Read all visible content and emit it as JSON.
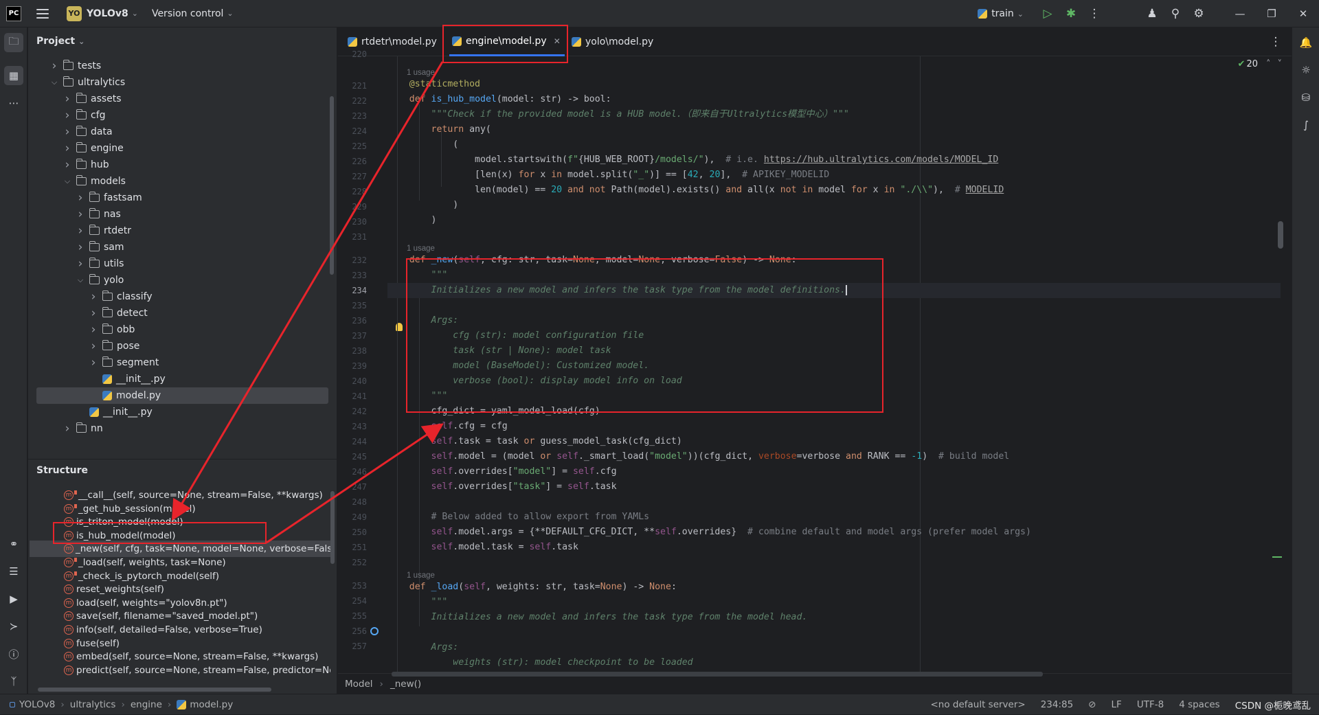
{
  "topbar": {
    "logo": "PC",
    "project_badge": "YO",
    "project_name": "YOLOv8",
    "version_control": "Version control",
    "run_config": "train"
  },
  "project_panel": {
    "title": "Project",
    "tree": [
      {
        "label": "tests",
        "type": "folder",
        "depth": 1,
        "expanded": false
      },
      {
        "label": "ultralytics",
        "type": "folder",
        "depth": 1,
        "expanded": true
      },
      {
        "label": "assets",
        "type": "folder",
        "depth": 2,
        "expanded": false
      },
      {
        "label": "cfg",
        "type": "folder",
        "depth": 2,
        "expanded": false
      },
      {
        "label": "data",
        "type": "folder",
        "depth": 2,
        "expanded": false
      },
      {
        "label": "engine",
        "type": "folder",
        "depth": 2,
        "expanded": false
      },
      {
        "label": "hub",
        "type": "folder",
        "depth": 2,
        "expanded": false
      },
      {
        "label": "models",
        "type": "folder",
        "depth": 2,
        "expanded": true
      },
      {
        "label": "fastsam",
        "type": "folder",
        "depth": 3,
        "expanded": false
      },
      {
        "label": "nas",
        "type": "folder",
        "depth": 3,
        "expanded": false
      },
      {
        "label": "rtdetr",
        "type": "folder",
        "depth": 3,
        "expanded": false
      },
      {
        "label": "sam",
        "type": "folder",
        "depth": 3,
        "expanded": false
      },
      {
        "label": "utils",
        "type": "folder",
        "depth": 3,
        "expanded": false
      },
      {
        "label": "yolo",
        "type": "folder",
        "depth": 3,
        "expanded": true
      },
      {
        "label": "classify",
        "type": "folder",
        "depth": 4,
        "expanded": false
      },
      {
        "label": "detect",
        "type": "folder",
        "depth": 4,
        "expanded": false
      },
      {
        "label": "obb",
        "type": "folder",
        "depth": 4,
        "expanded": false
      },
      {
        "label": "pose",
        "type": "folder",
        "depth": 4,
        "expanded": false
      },
      {
        "label": "segment",
        "type": "folder",
        "depth": 4,
        "expanded": false
      },
      {
        "label": "__init__.py",
        "type": "file",
        "depth": 4
      },
      {
        "label": "model.py",
        "type": "file",
        "depth": 4,
        "selected": true
      },
      {
        "label": "__init__.py",
        "type": "file",
        "depth": 3
      },
      {
        "label": "nn",
        "type": "folder",
        "depth": 2,
        "expanded": false
      }
    ]
  },
  "structure_panel": {
    "title": "Structure",
    "items": [
      {
        "label": "__call__(self, source=None, stream=False, **kwargs)",
        "private": true
      },
      {
        "label": "_get_hub_session(model)",
        "private": true
      },
      {
        "label": "is_triton_model(model)",
        "private": false
      },
      {
        "label": "is_hub_model(model)",
        "private": false
      },
      {
        "label": "_new(self, cfg, task=None, model=None, verbose=False)",
        "private": true,
        "selected": true
      },
      {
        "label": "_load(self, weights, task=None)",
        "private": true
      },
      {
        "label": "_check_is_pytorch_model(self)",
        "private": true
      },
      {
        "label": "reset_weights(self)",
        "private": false
      },
      {
        "label": "load(self, weights=\"yolov8n.pt\")",
        "private": false
      },
      {
        "label": "save(self, filename=\"saved_model.pt\")",
        "private": false
      },
      {
        "label": "info(self, detailed=False, verbose=True)",
        "private": false
      },
      {
        "label": "fuse(self)",
        "private": false
      },
      {
        "label": "embed(self, source=None, stream=False, **kwargs)",
        "private": false
      },
      {
        "label": "predict(self, source=None, stream=False, predictor=None, **kwargs)",
        "private": false
      }
    ]
  },
  "tabs": [
    {
      "label": "rtdetr\\model.py",
      "active": false
    },
    {
      "label": "engine\\model.py",
      "active": true
    },
    {
      "label": "yolo\\model.py",
      "active": false
    }
  ],
  "editor": {
    "inspection_count": "20",
    "usage_hint": "1 usage",
    "current_line": "234",
    "line_numbers": [
      "220",
      "221",
      "222",
      "223",
      "224",
      "225",
      "226",
      "227",
      "228",
      "229",
      "230",
      "231",
      "232",
      "233",
      "234",
      "235",
      "236",
      "237",
      "238",
      "239",
      "240",
      "241",
      "242",
      "243",
      "244",
      "245",
      "246",
      "247",
      "248",
      "249",
      "250",
      "251",
      "252",
      "253",
      "254",
      "255",
      "256",
      "257"
    ],
    "breadcrumb": [
      "Model",
      "_new()"
    ]
  },
  "statusbar": {
    "path": [
      "YOLOv8",
      "ultralytics",
      "engine",
      "model.py"
    ],
    "server": "<no default server>",
    "position": "234:85",
    "line_sep": "LF",
    "encoding": "UTF-8",
    "indent": "4 spaces",
    "watermark": "CSDN @栀晚鸢乱"
  }
}
